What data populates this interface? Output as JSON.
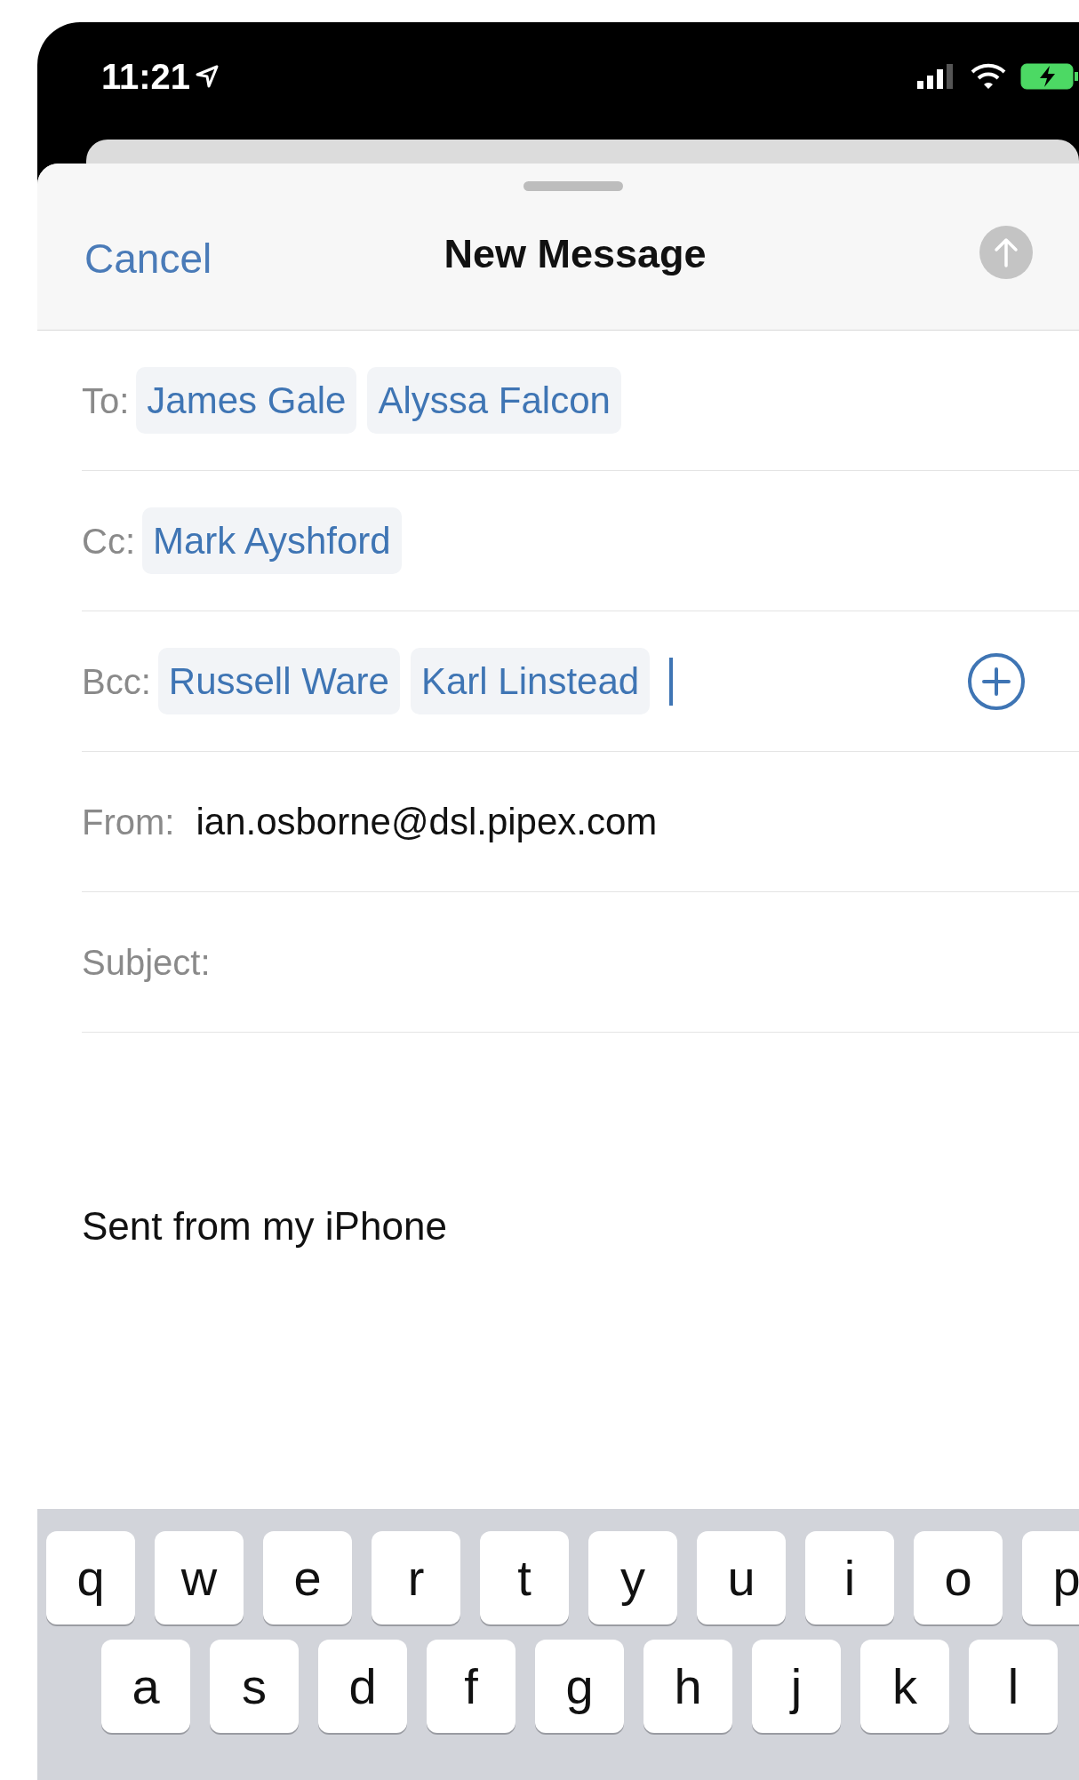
{
  "status_bar": {
    "time": "11:21"
  },
  "header": {
    "cancel": "Cancel",
    "title": "New Message",
    "send_disabled": true
  },
  "fields": [
    {
      "label": "To:",
      "kind": "recipients",
      "recipients": [
        "James Gale",
        "Alyssa Falcon"
      ],
      "focused": false
    },
    {
      "label": "Cc:",
      "kind": "recipients",
      "recipients": [
        "Mark Ayshford"
      ],
      "focused": false
    },
    {
      "label": "Bcc:",
      "kind": "recipients",
      "recipients": [
        "Russell Ware",
        "Karl Linstead"
      ],
      "focused": true
    },
    {
      "label": "From:",
      "kind": "text",
      "value": "ian.osborne@dsl.pipex.com"
    },
    {
      "label": "Subject:",
      "kind": "text"
    }
  ],
  "body": {
    "signature": "Sent from my iPhone"
  },
  "keyboard": {
    "rows": [
      [
        "q",
        "w",
        "e",
        "r",
        "t",
        "y",
        "u",
        "i",
        "o",
        "p"
      ],
      [
        "a",
        "s",
        "d",
        "f",
        "g",
        "h",
        "j",
        "k",
        "l"
      ]
    ]
  }
}
